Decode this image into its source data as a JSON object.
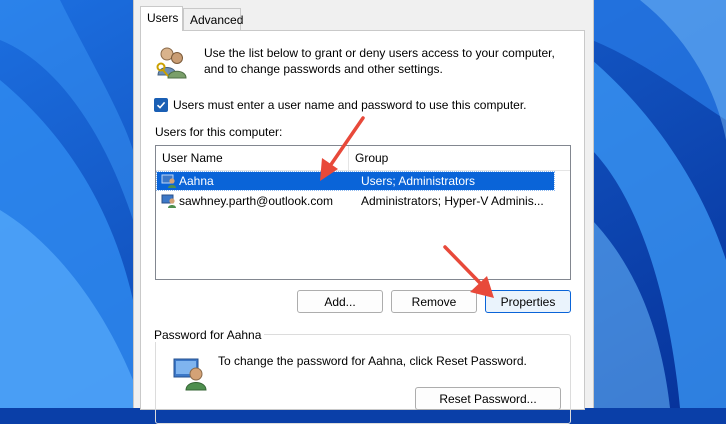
{
  "tabs": [
    {
      "label": "Users",
      "active": true
    },
    {
      "label": "Advanced",
      "active": false
    }
  ],
  "intro_text": "Use the list below to grant or deny users access to your computer, and to change passwords and other settings.",
  "require_password": {
    "label": "Users must enter a user name and password to use this computer.",
    "checked": true
  },
  "users_section_label": "Users for this computer:",
  "list": {
    "columns": [
      "User Name",
      "Group"
    ],
    "rows": [
      {
        "user": "Aahna",
        "group": "Users; Administrators",
        "selected": true
      },
      {
        "user": "sawhney.parth@outlook.com",
        "group": "Administrators; Hyper-V Adminis...",
        "selected": false
      }
    ]
  },
  "buttons": {
    "add": "Add...",
    "remove": "Remove",
    "properties": "Properties",
    "reset_password": "Reset Password..."
  },
  "password_group": {
    "legend": "Password for Aahna",
    "text": "To change the password for Aahna, click Reset Password."
  },
  "colors": {
    "selection": "#0a64d8",
    "annotation_arrow": "#e8493a",
    "checkbox": "#1a5fb4"
  }
}
